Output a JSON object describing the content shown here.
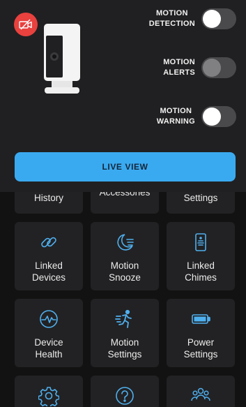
{
  "device": {
    "status_icon": "camera-off-icon"
  },
  "toggles": [
    {
      "label": "MOTION\nDETECTION",
      "state": "off"
    },
    {
      "label": "MOTION\nALERTS",
      "state": "disabled"
    },
    {
      "label": "MOTION\nWARNING",
      "state": "off"
    }
  ],
  "live_view": {
    "label": "LIVE VIEW"
  },
  "tiles": {
    "history": {
      "label": "History"
    },
    "accessories": {
      "label": "Accessories"
    },
    "settings": {
      "label": "Settings"
    },
    "linked_devices": {
      "label": "Linked\nDevices",
      "icon": "link-icon"
    },
    "motion_snooze": {
      "label": "Motion\nSnooze",
      "icon": "moon-snooze-icon"
    },
    "linked_chimes": {
      "label": "Linked\nChimes",
      "icon": "chime-icon"
    },
    "device_health": {
      "label": "Device\nHealth",
      "icon": "pulse-icon"
    },
    "motion_settings": {
      "label": "Motion\nSettings",
      "icon": "running-person-icon"
    },
    "power_settings": {
      "label": "Power\nSettings",
      "icon": "battery-icon"
    },
    "row4": [
      {
        "icon": "gear-icon"
      },
      {
        "icon": "help-icon"
      },
      {
        "icon": "users-icon"
      }
    ]
  },
  "colors": {
    "accent": "#3aaaf0",
    "icon": "#4fb0ef",
    "alert": "#e8413e",
    "panel": "#202022",
    "tile": "#222224",
    "background": "#121212"
  }
}
